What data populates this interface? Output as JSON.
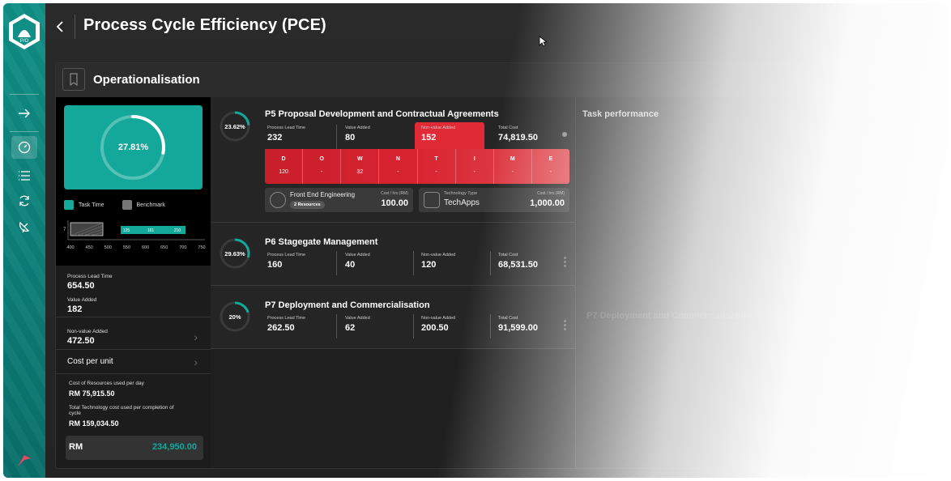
{
  "app": {
    "page_title": "Process Cycle Efficiency (PCE)",
    "panel_title": "Operationalisation"
  },
  "summary": {
    "donut_value": "27.81%",
    "donut_fraction": 0.2781,
    "legend": [
      {
        "label": "Task Time",
        "color": "#14a89b"
      },
      {
        "label": "Benchmark",
        "color": "#777777"
      }
    ],
    "bar_chart": {
      "row_label": "7",
      "values": [
        "125",
        "161",
        "210"
      ],
      "axis_ticks": [
        "400",
        "450",
        "500",
        "550",
        "600",
        "650",
        "700",
        "750"
      ]
    },
    "process_lead_time_label": "Process Lead Time",
    "process_lead_time_value": "654.50",
    "value_added_label": "Value Added",
    "value_added_value": "182",
    "non_value_added_label": "Non-value Added",
    "non_value_added_value": "472.50",
    "cost_per_unit_label": "Cost per unit",
    "resources_cost_label": "Cost of Resources used per day",
    "resources_cost_value": "RM 75,915.50",
    "tech_cost_label": "Total Technology cost used per completion of cycle",
    "tech_cost_value": "RM 159,034.50",
    "total_label": "RM",
    "total_value": "234,950.00"
  },
  "processes": [
    {
      "pct": "23.62%",
      "fraction": 0.2362,
      "title": "P5 Proposal Development and Contractual Agreements",
      "metrics": [
        {
          "label": "Process Lead Time",
          "value": "232"
        },
        {
          "label": "Value Added",
          "value": "80"
        },
        {
          "label": "Non-value Added",
          "value": "152"
        },
        {
          "label": "Total Cost",
          "value": "74,819.50"
        }
      ],
      "waste_grid": [
        {
          "letter": "D",
          "value": "120"
        },
        {
          "letter": "O",
          "value": "-"
        },
        {
          "letter": "W",
          "value": "32"
        },
        {
          "letter": "N",
          "value": "-"
        },
        {
          "letter": "T",
          "value": "-"
        },
        {
          "letter": "I",
          "value": "-"
        },
        {
          "letter": "M",
          "value": "-"
        },
        {
          "letter": "E",
          "value": "-"
        }
      ],
      "resource_card": {
        "name": "Front End Engineering",
        "badge": "2 Resources",
        "cost_label": "Cost / hrs (RM)",
        "cost_value": "100.00"
      },
      "tech_card": {
        "type_label": "Technology Type",
        "name": "TechApps",
        "cost_label": "Cost / hrs (RM)",
        "cost_value": "1,000.00"
      }
    },
    {
      "pct": "29.63%",
      "fraction": 0.2963,
      "title": "P6 Stagegate Management",
      "metrics": [
        {
          "label": "Process Lead Time",
          "value": "160"
        },
        {
          "label": "Value Added",
          "value": "40"
        },
        {
          "label": "Non-value Added",
          "value": "120"
        },
        {
          "label": "Total Cost",
          "value": "68,531.50"
        }
      ]
    },
    {
      "pct": "20%",
      "fraction": 0.2,
      "title": "P7 Deployment and Commercialisation",
      "metrics": [
        {
          "label": "Process Lead Time",
          "value": "262.50"
        },
        {
          "label": "Value Added",
          "value": "62"
        },
        {
          "label": "Non-value Added",
          "value": "200.50"
        },
        {
          "label": "Total Cost",
          "value": "91,599.00"
        }
      ]
    }
  ],
  "right_panel": {
    "title": "Task performance",
    "faded_title": "P7 Deployment and Commercialisation"
  },
  "colors": {
    "teal": "#14a89b",
    "red": "#e02a36"
  }
}
